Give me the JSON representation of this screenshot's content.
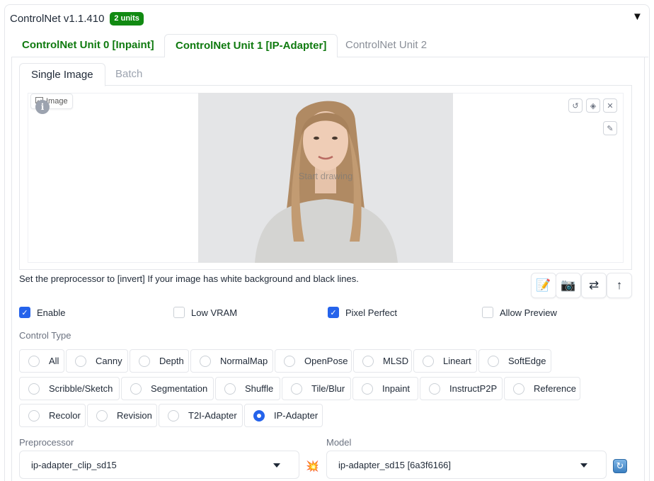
{
  "header": {
    "title": "ControlNet v1.1.410",
    "badge": "2 units",
    "collapse_icon": "▼"
  },
  "unit_tabs": [
    {
      "label": "ControlNet Unit 0 [Inpaint]",
      "state": "inactive-highlighted"
    },
    {
      "label": "ControlNet Unit 1 [IP-Adapter]",
      "state": "active"
    },
    {
      "label": "ControlNet Unit 2",
      "state": "inactive"
    }
  ],
  "image_tabs": [
    {
      "label": "Single Image",
      "state": "active"
    },
    {
      "label": "Batch",
      "state": "inactive"
    }
  ],
  "image_panel": {
    "label": "Image",
    "overlay_text": "Start drawing",
    "info_icon": "i",
    "tools": [
      "undo-icon",
      "erase-icon",
      "close-icon",
      "brush-icon"
    ]
  },
  "hint_text": "Set the preprocessor to [invert] If your image has white background and black lines.",
  "action_buttons": [
    "edit-icon",
    "camera-icon",
    "swap-icon",
    "send-up-icon"
  ],
  "options": [
    {
      "label": "Enable",
      "checked": true
    },
    {
      "label": "Low VRAM",
      "checked": false
    },
    {
      "label": "Pixel Perfect",
      "checked": true
    },
    {
      "label": "Allow Preview",
      "checked": false
    }
  ],
  "control_type": {
    "label": "Control Type",
    "selected": "IP-Adapter",
    "rows": [
      [
        "All",
        "Canny",
        "Depth",
        "NormalMap",
        "OpenPose",
        "MLSD",
        "Lineart",
        "SoftEdge"
      ],
      [
        "Scribble/Sketch",
        "Segmentation",
        "Shuffle",
        "Tile/Blur",
        "Inpaint",
        "InstructP2P",
        "Reference"
      ],
      [
        "Recolor",
        "Revision",
        "T2I-Adapter",
        "IP-Adapter"
      ]
    ]
  },
  "preprocessor": {
    "label": "Preprocessor",
    "value": "ip-adapter_clip_sd15"
  },
  "model": {
    "label": "Model",
    "value": "ip-adapter_sd15 [6a3f6166]"
  },
  "colors": {
    "accent_green": "#0f7a0f",
    "badge_green": "#118a12",
    "primary_blue": "#2563eb"
  }
}
